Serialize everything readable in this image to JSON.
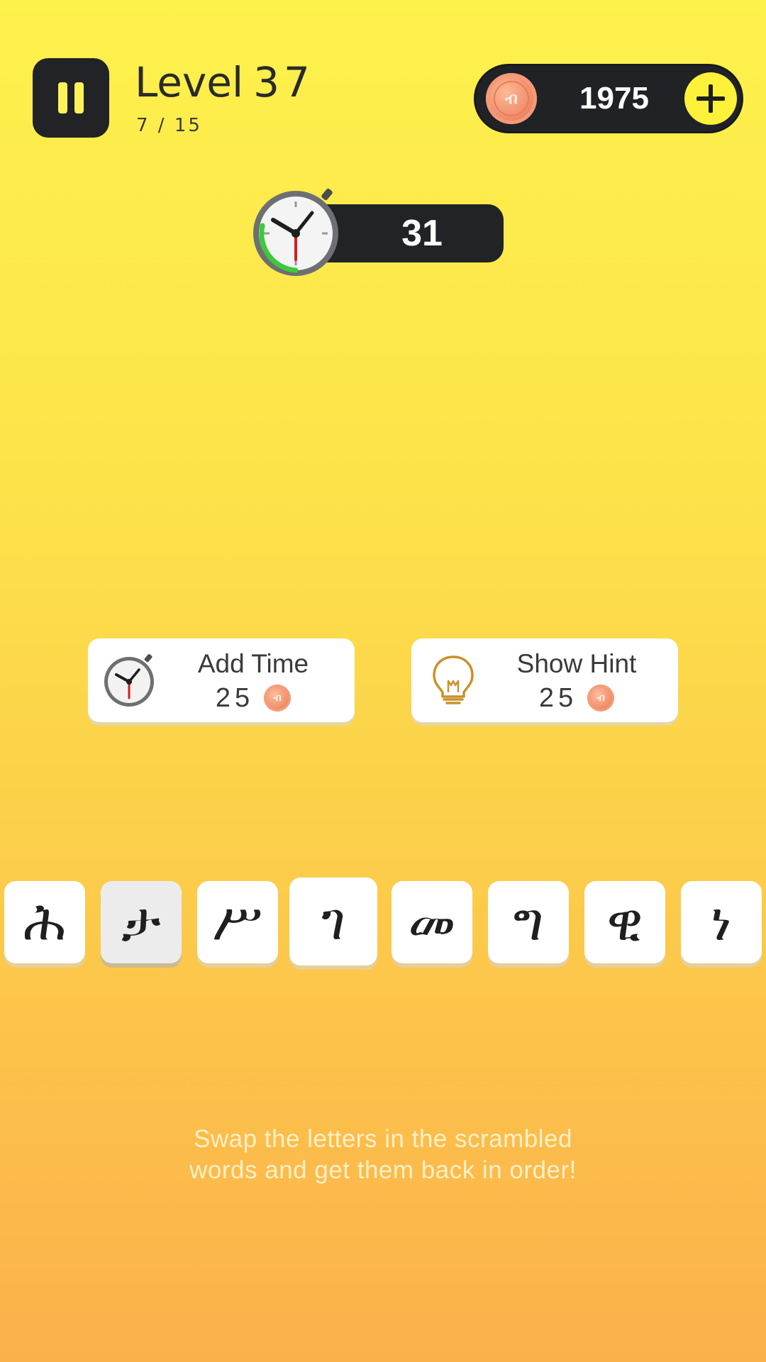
{
  "header": {
    "level_label": "Level",
    "level_number": "37",
    "progress": "7 / 15",
    "coins": "1975"
  },
  "timer": {
    "seconds_left": "31"
  },
  "powerups": {
    "add_time": {
      "label": "Add Time",
      "cost": "25"
    },
    "show_hint": {
      "label": "Show Hint",
      "cost": "25"
    }
  },
  "tiles": [
    "ሕ",
    "ታ",
    "ሥ",
    "ገ",
    "መ",
    "ግ",
    "ዊ",
    "ነ"
  ],
  "selected_tile_index": 1,
  "instruction": {
    "line1": "Swap the letters in the scrambled",
    "line2": "words and get them back in order!"
  },
  "colors": {
    "background_top": "#fdf14c",
    "background_bottom": "#fbb04c",
    "dark_pill": "#222326",
    "accent_yellow": "#fdf13a",
    "coin_orange": "#f28f6a",
    "timer_green": "#3ec93a"
  },
  "icons": {
    "pause": "pause-icon",
    "coin": "coin-icon",
    "add": "plus-icon",
    "timer": "stopwatch-icon",
    "hint": "lightbulb-icon"
  }
}
